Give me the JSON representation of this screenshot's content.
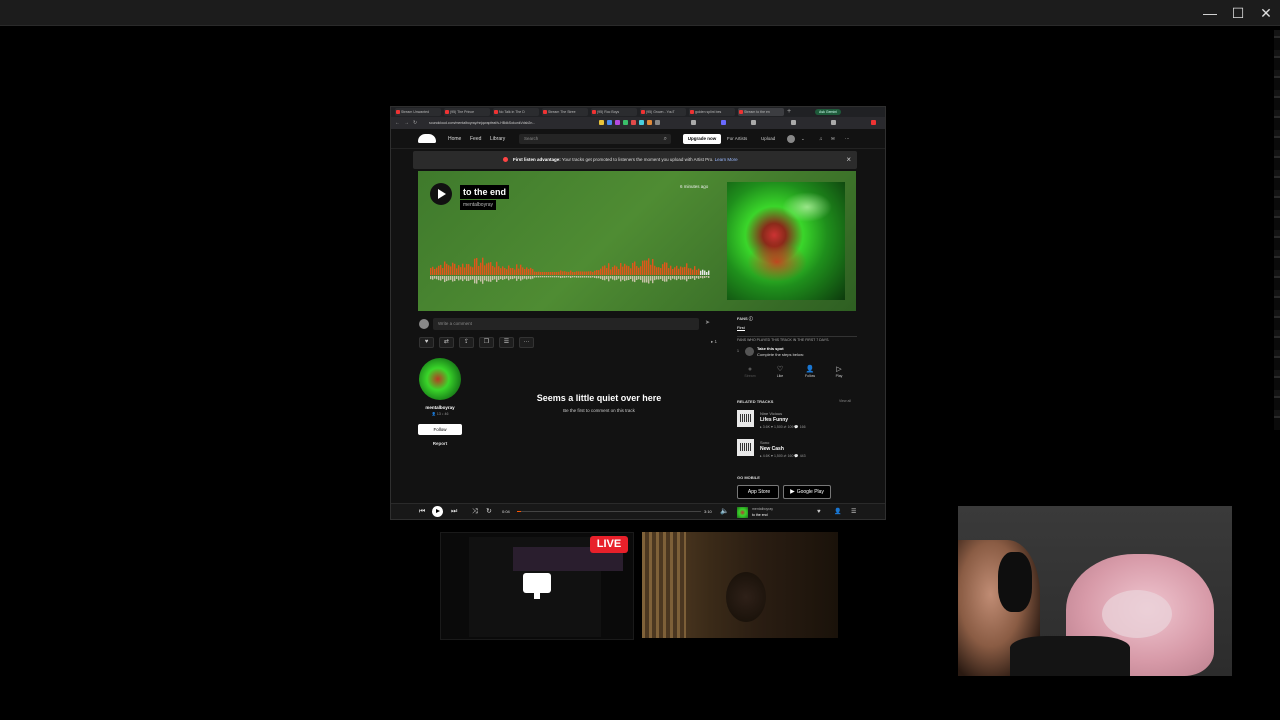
{
  "window": {
    "minimize": "—",
    "maximize": "☐",
    "close": "✕"
  },
  "tabs": [
    {
      "label": "Stream Unwanted"
    },
    {
      "label": "(95) The Prince"
    },
    {
      "label": "No Talk in The D"
    },
    {
      "label": "Stream The Stree"
    },
    {
      "label": "(95) Roc Boys"
    },
    {
      "label": "(95) Grown - YouT"
    },
    {
      "label": "golden splint bes"
    },
    {
      "label": "Stream to the en"
    }
  ],
  "tab_new": "+",
  "ask_button": "Ask Gemini",
  "url": "soundcloud.com/mentalboyray/nnjqwapfeaf/s-HBdkSokunkVdsb2n...",
  "header": {
    "nav": [
      "Home",
      "Feed",
      "Library"
    ],
    "search_placeholder": "Search",
    "upgrade": "Upgrade now",
    "for_artists": "For Artists",
    "upload": "Upload"
  },
  "banner": {
    "bold": "First listen advantage:",
    "text": " Your tracks get promoted to listeners the moment you upload with Artist Pro.",
    "link": "Learn More"
  },
  "track": {
    "title": "to the end",
    "artist": "mentalboyray",
    "posted": "6 minutes ago"
  },
  "comment": {
    "placeholder": "Write a comment"
  },
  "actions": [
    "♥",
    "⇄",
    "⇪",
    "❐",
    "☰",
    "···"
  ],
  "plays": "▸ 1",
  "artist_block": {
    "name": "mentalboyray",
    "stats": "👤 13  ♪ 46",
    "follow": "Follow",
    "report": "Report"
  },
  "empty_comments": {
    "title": "Seems a little quiet over here",
    "subtitle": "Be the first to comment on this track"
  },
  "fans": {
    "heading": "FANS ⓘ",
    "tab": "First",
    "note": "FANS WHO PLAYED THIS TRACK IN THE FIRST 7 DAYS.",
    "rank": "1",
    "slot_title": "Take this spot",
    "slot_sub": "Complete the steps below:",
    "steps": [
      {
        "icon": "●",
        "label": "Stream",
        "dim": true
      },
      {
        "icon": "♡",
        "label": "Like",
        "dim": false
      },
      {
        "icon": "👤",
        "label": "Follow",
        "dim": false
      },
      {
        "icon": "▷",
        "label": "Play",
        "dim": false
      }
    ]
  },
  "related": {
    "heading": "RELATED TRACKS",
    "view_all": "View all",
    "items": [
      {
        "artist": "Nine Vicious",
        "title": "Lifes Funny",
        "stats": "▸ 3.6K  ♥ 1,500  ⇄ 109  💬 166"
      },
      {
        "artist": "Sono",
        "title": "New Cash",
        "stats": "▸ 4.6K  ♥ 1,500  ⇄ 160  💬 443"
      }
    ]
  },
  "mobile": {
    "heading": "GO MOBILE",
    "app_store": "App Store",
    "google_play": "Google Play"
  },
  "player": {
    "elapsed": "0:04",
    "duration": "3:10",
    "progress": 0.02,
    "artist": "mentalboyray",
    "title": "to the end"
  },
  "live_badge": "LIVE"
}
